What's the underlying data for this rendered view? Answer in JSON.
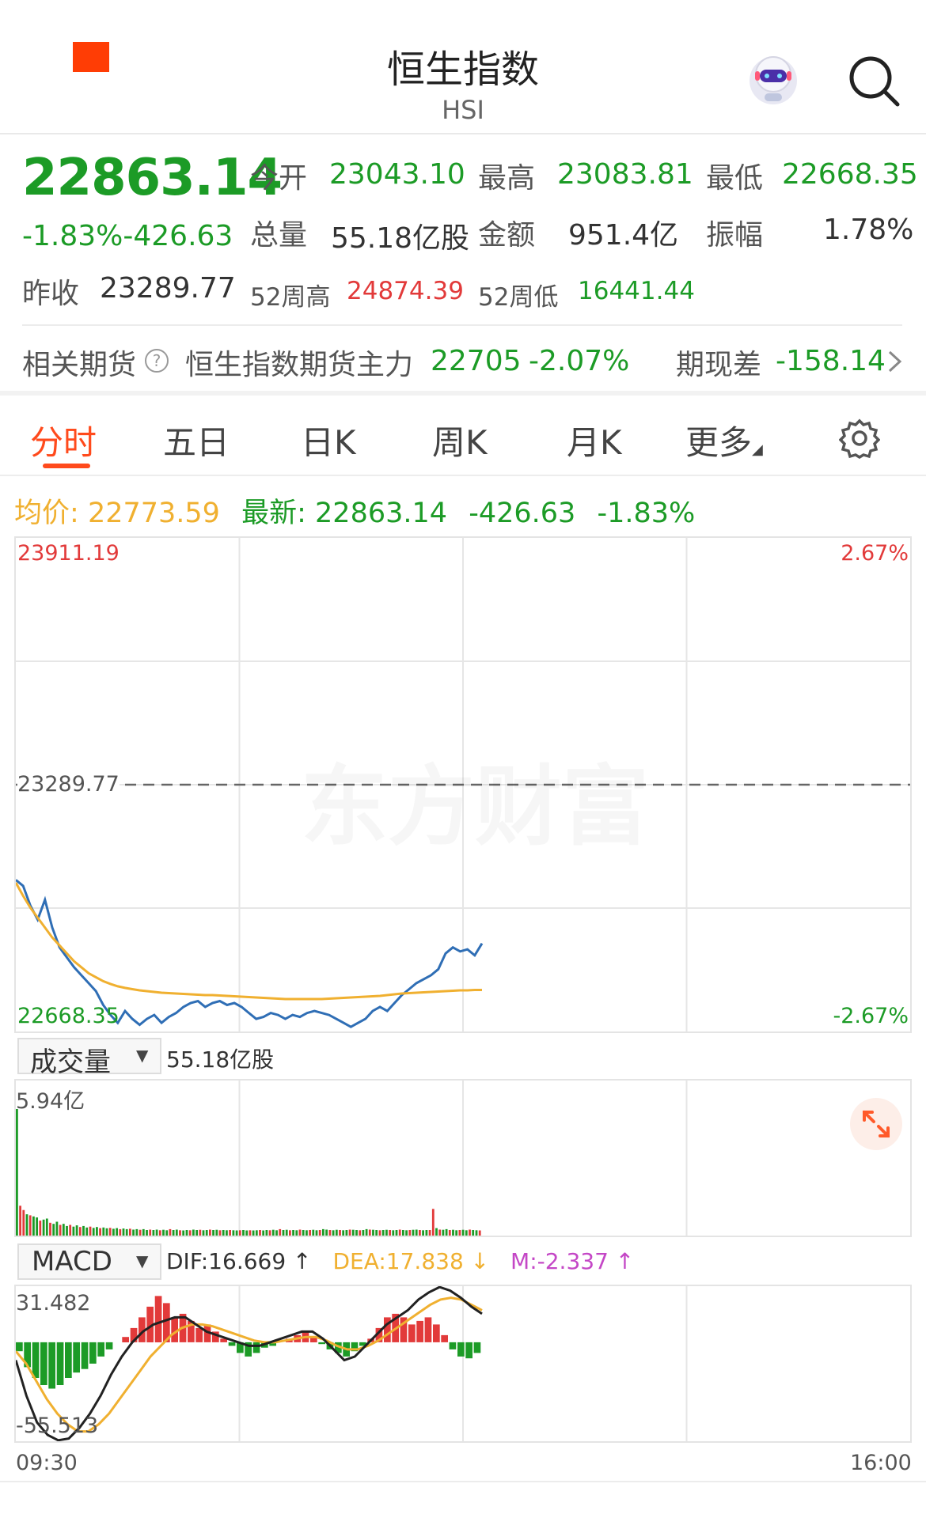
{
  "header": {
    "title": "恒生指数",
    "code": "HSI"
  },
  "quote": {
    "price": "22863.14",
    "change_pct": "-1.83%",
    "change": "-426.63",
    "open_label": "今开",
    "open": "23043.10",
    "high_label": "最高",
    "high": "23083.81",
    "low_label": "最低",
    "low": "22668.35",
    "volume_label": "总量",
    "volume": "55.18亿股",
    "amount_label": "金额",
    "amount": "951.4亿",
    "amplitude_label": "振幅",
    "amplitude": "1.78%",
    "prev_close_label": "昨收",
    "prev_close": "23289.77",
    "wk52_high_label": "52周高",
    "wk52_high": "24874.39",
    "wk52_low_label": "52周低",
    "wk52_low": "16441.44"
  },
  "futures": {
    "label": "相关期货",
    "name": "恒生指数期货主力",
    "price": "22705",
    "pct": "-2.07%",
    "basis_label": "期现差",
    "basis": "-158.14"
  },
  "tabs": [
    {
      "label": "分时",
      "active": true
    },
    {
      "label": "五日"
    },
    {
      "label": "日K"
    },
    {
      "label": "周K"
    },
    {
      "label": "月K"
    },
    {
      "label": "更多"
    }
  ],
  "info_line": {
    "avg_label": "均价:",
    "avg": "22773.59",
    "latest_label": "最新:",
    "latest": "22863.14",
    "change": "-426.63",
    "pct": "-1.83%"
  },
  "watermark": "东方财富",
  "colors": {
    "up": "#e23a3a",
    "down": "#1c9b26",
    "price_line": "#2f6eb5",
    "avg_line": "#f0b030",
    "accent": "#ff4a1c"
  },
  "chart_data": [
    {
      "type": "line",
      "name": "intraday",
      "y_max_label": "23911.19",
      "y_min_label": "22668.35",
      "prev_close_label": "23289.77",
      "pct_top": "2.67%",
      "pct_bottom": "-2.67%",
      "x_start": "09:30",
      "x_end": "16:00",
      "ylim": [
        22668.35,
        23911.19
      ],
      "prev_close": 23289.77,
      "series": [
        {
          "name": "最新",
          "values": [
            23050,
            23035,
            22985,
            22950,
            23000,
            22930,
            22880,
            22855,
            22830,
            22810,
            22790,
            22770,
            22735,
            22710,
            22690,
            22720,
            22700,
            22685,
            22700,
            22710,
            22690,
            22705,
            22715,
            22730,
            22740,
            22745,
            22730,
            22740,
            22745,
            22735,
            22740,
            22730,
            22715,
            22700,
            22705,
            22715,
            22710,
            22700,
            22710,
            22705,
            22715,
            22720,
            22715,
            22710,
            22700,
            22690,
            22680,
            22690,
            22700,
            22720,
            22730,
            22720,
            22740,
            22760,
            22775,
            22790,
            22800,
            22810,
            22825,
            22865,
            22880,
            22870,
            22875,
            22860,
            22890
          ]
        },
        {
          "name": "均价",
          "values": [
            23043,
            23010,
            22980,
            22955,
            22930,
            22905,
            22885,
            22865,
            22845,
            22830,
            22815,
            22805,
            22795,
            22788,
            22782,
            22778,
            22775,
            22772,
            22770,
            22768,
            22766,
            22765,
            22764,
            22763,
            22762,
            22761,
            22760,
            22760,
            22759,
            22758,
            22757,
            22756,
            22755,
            22754,
            22753,
            22752,
            22751,
            22750,
            22750,
            22750,
            22750,
            22750,
            22750,
            22751,
            22752,
            22753,
            22754,
            22755,
            22756,
            22757,
            22758,
            22760,
            22762,
            22764,
            22765,
            22766,
            22767,
            22768,
            22769,
            22770,
            22771,
            22772,
            22772,
            22773,
            22773
          ]
        }
      ]
    },
    {
      "type": "bar",
      "name": "volume",
      "selector_label": "成交量",
      "total": "55.18亿股",
      "y_max_label": "5.94亿",
      "values": [
        5.94,
        1.4,
        1.2,
        1.0,
        0.95,
        0.9,
        0.85,
        0.7,
        0.75,
        0.8,
        0.6,
        0.55,
        0.65,
        0.5,
        0.55,
        0.45,
        0.5,
        0.42,
        0.48,
        0.4,
        0.45,
        0.38,
        0.42,
        0.36,
        0.4,
        0.35,
        0.38,
        0.34,
        0.36,
        0.32,
        0.35,
        0.3,
        0.33,
        0.3,
        0.32,
        0.28,
        0.3,
        0.27,
        0.3,
        0.26,
        0.28,
        0.26,
        0.28,
        0.25,
        0.27,
        0.25,
        0.3,
        0.26,
        0.28,
        0.25,
        0.24,
        0.26,
        0.25,
        0.28,
        0.26,
        0.27,
        0.25,
        0.26,
        0.28,
        0.26,
        0.27,
        0.25,
        0.26,
        0.25,
        0.26,
        0.25,
        0.24,
        0.25,
        0.26,
        0.24,
        0.25,
        0.24,
        0.25,
        0.26,
        0.24,
        0.26,
        0.25,
        0.27,
        0.25,
        0.3,
        0.26,
        0.27,
        0.25,
        0.26,
        0.25,
        0.28,
        0.26,
        0.25,
        0.26,
        0.27,
        0.25,
        0.26,
        0.3,
        0.28,
        0.26,
        0.25,
        0.27,
        0.26,
        0.25,
        0.26,
        0.28,
        0.27,
        0.26,
        0.25,
        0.26,
        0.3,
        0.28,
        0.27,
        0.26,
        0.25,
        0.26,
        0.27,
        0.26,
        0.25,
        0.26,
        0.28,
        0.26,
        0.25,
        0.26,
        0.27,
        0.28,
        0.26,
        0.25,
        0.26,
        0.26,
        1.25,
        0.35,
        0.28,
        0.27,
        0.3,
        0.26,
        0.27,
        0.25,
        0.26,
        0.27,
        0.25,
        0.28,
        0.26,
        0.25,
        0.24
      ]
    },
    {
      "type": "bar",
      "name": "macd",
      "selector_label": "MACD",
      "dif_label": "DIF:16.669 ↑",
      "dea_label": "DEA:17.838 ↓",
      "m_label": "M:-2.337 ↑",
      "y_max_label": "31.482",
      "y_min_label": "-55.513",
      "ylim": [
        -55.513,
        31.482
      ],
      "hist": [
        -5,
        -14,
        -20,
        -24,
        -26,
        -24,
        -20,
        -17,
        -15,
        -12,
        -8,
        -4,
        0,
        3,
        8,
        14,
        20,
        26,
        22,
        14,
        16,
        12,
        8,
        10,
        6,
        2,
        -2,
        -6,
        -8,
        -6,
        -3,
        -2,
        0,
        2,
        4,
        6,
        3,
        -1,
        -4,
        -6,
        -8,
        -5,
        -2,
        2,
        8,
        14,
        16,
        14,
        10,
        12,
        14,
        10,
        4,
        -4,
        -8,
        -9,
        -6
      ],
      "dif": [
        -10,
        -30,
        -45,
        -52,
        -55,
        -54,
        -48,
        -40,
        -30,
        -18,
        -8,
        0,
        6,
        10,
        12,
        14,
        14,
        10,
        6,
        4,
        2,
        0,
        -2,
        -2,
        0,
        2,
        4,
        6,
        6,
        2,
        -4,
        -10,
        -8,
        -2,
        4,
        10,
        14,
        18,
        24,
        28,
        31,
        29,
        25,
        20,
        16
      ],
      "dea": [
        -5,
        -12,
        -22,
        -32,
        -40,
        -46,
        -50,
        -50,
        -46,
        -40,
        -32,
        -24,
        -16,
        -8,
        -2,
        4,
        8,
        10,
        10,
        9,
        7,
        5,
        3,
        1,
        0,
        0,
        1,
        2,
        3,
        3,
        1,
        -2,
        -4,
        -4,
        -2,
        1,
        5,
        9,
        13,
        17,
        21,
        24,
        25,
        24,
        21,
        18
      ]
    }
  ]
}
